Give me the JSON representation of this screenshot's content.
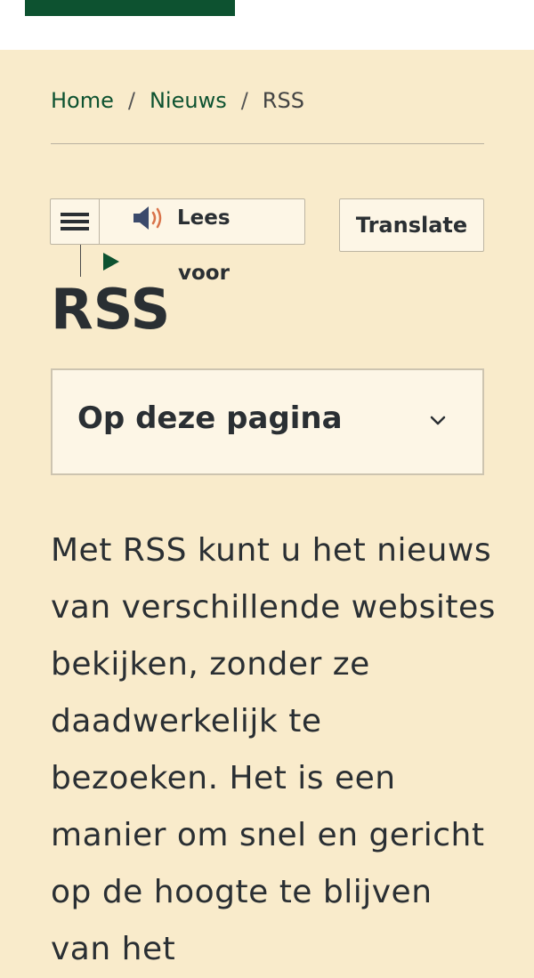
{
  "header": {
    "brand_color": "#0d5230"
  },
  "breadcrumb": {
    "items": [
      "Home",
      "Nieuws",
      "RSS"
    ],
    "separator": "/"
  },
  "reader": {
    "label_line1": "Lees",
    "label_line2": "voor",
    "menu_icon": "hamburger-icon",
    "speaker_icon": "speaker-icon",
    "play_icon": "play-icon"
  },
  "translate": {
    "label": "Translate"
  },
  "page": {
    "title": "RSS"
  },
  "toc": {
    "title": "Op deze pagina",
    "icon": "chevron-down-icon"
  },
  "content": {
    "intro": "Met RSS kunt u het nieuws van verschillende websites bekijken, zonder ze daadwerkelijk te bezoeken. Het is een manier om snel en gericht op de hoogte te blijven van het"
  },
  "colors": {
    "background": "#f9ebcb",
    "accent": "#0d5230",
    "text": "#2a2f33"
  }
}
